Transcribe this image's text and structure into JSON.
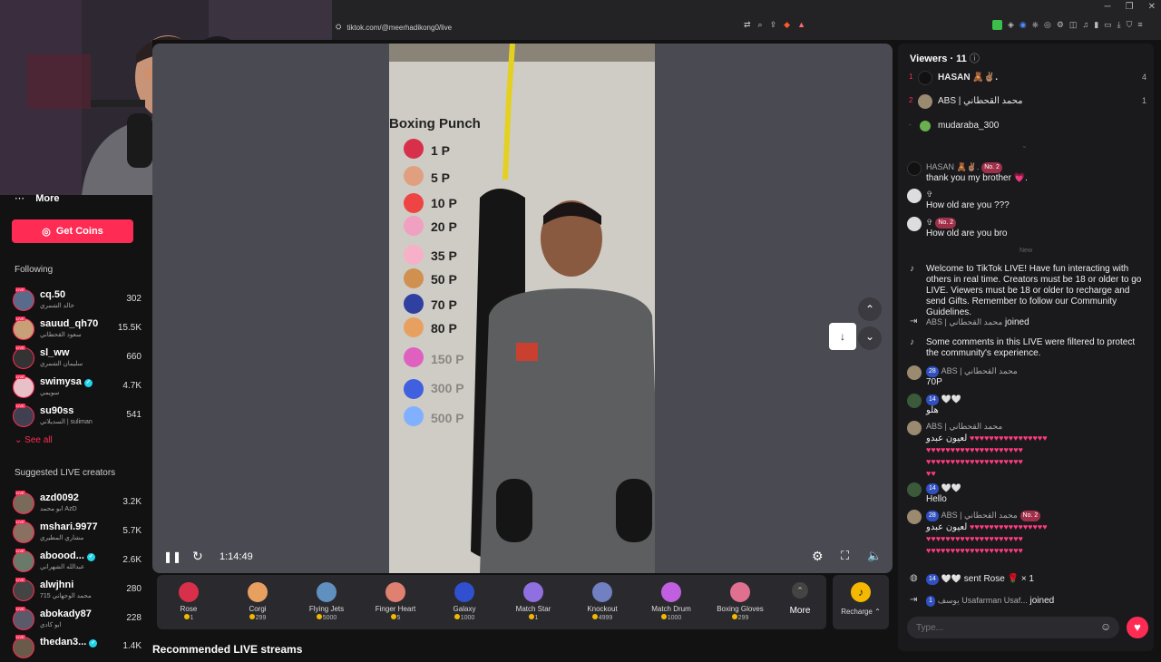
{
  "browser": {
    "url": "tiktok.com/@meerhadikong0/live",
    "window_controls": [
      "─",
      "❐",
      "✕"
    ]
  },
  "sidebar": {
    "more_label": "More",
    "get_coins_label": "Get Coins",
    "following_heading": "Following",
    "following": [
      {
        "name": "cq.50",
        "sub": "خالد الشمري",
        "count": "302"
      },
      {
        "name": "sauud_qh70",
        "sub": "سعود القحطاني",
        "count": "15.5K"
      },
      {
        "name": "sl_ww",
        "sub": "سليمان الشمري",
        "count": "660"
      },
      {
        "name": "swimysa",
        "sub": "سويمي",
        "count": "4.7K"
      },
      {
        "name": "su90ss",
        "sub": "السديلاني | suliman",
        "count": "541"
      }
    ],
    "see_all_label": "See all",
    "suggested_heading": "Suggested LIVE creators",
    "suggested": [
      {
        "name": "azd0092",
        "sub": "ابو محمد AzD",
        "count": "3.2K"
      },
      {
        "name": "mshari.9977",
        "sub": "مشاري المطيري",
        "count": "5.7K"
      },
      {
        "name": "aboood...",
        "sub": "عبدالله الشهراني",
        "count": "2.6K"
      },
      {
        "name": "alwjhni",
        "sub": "محمد الوجهاني 715",
        "count": "280"
      },
      {
        "name": "abokady87",
        "sub": "ابو كادي",
        "count": "228"
      },
      {
        "name": "thedan3...",
        "sub": "",
        "count": "1.4K"
      }
    ]
  },
  "video": {
    "title": "Boxing Punch",
    "prices": [
      "1 P",
      "5 P",
      "10 P",
      "20 P",
      "35 P",
      "50 P",
      "70 P",
      "80 P",
      "150 P",
      "300 P",
      "500 P"
    ],
    "time": "1:14:49"
  },
  "gifts": [
    {
      "name": "Rose",
      "price": "1"
    },
    {
      "name": "Corgi",
      "price": "299"
    },
    {
      "name": "Flying Jets",
      "price": "5000"
    },
    {
      "name": "Finger Heart",
      "price": "5"
    },
    {
      "name": "Galaxy",
      "price": "1000"
    },
    {
      "name": "Match Star",
      "price": "1"
    },
    {
      "name": "Knockout",
      "price": "4999"
    },
    {
      "name": "Match Drum",
      "price": "1000"
    },
    {
      "name": "Boxing Gloves",
      "price": "299"
    }
  ],
  "gift_more_label": "More",
  "recharge_label": "Recharge",
  "recommended_heading": "Recommended LIVE streams",
  "viewers": {
    "heading": "Viewers",
    "count": "11",
    "list": [
      {
        "rank": "1",
        "name": "HASAN 🧸✌🏽.",
        "score": "4"
      },
      {
        "rank": "2",
        "name": "ABS | محمد القحطاني",
        "score": "1"
      },
      {
        "rank": "-",
        "name": "mudaraba_300",
        "score": ""
      }
    ]
  },
  "chat": {
    "new_label": "New",
    "messages": [
      {
        "user": "HASAN 🧸✌🏽.",
        "badge": "No. 2",
        "text": "thank you my brother 💗."
      },
      {
        "user": "✞",
        "badge": "",
        "text": "How old are you ???"
      },
      {
        "user": "✞",
        "badge": "No. 2",
        "text": "How old are you bro"
      },
      {
        "user": "",
        "badge": "",
        "text": "Welcome to TikTok LIVE! Have fun interacting with others in real time. Creators must be 18 or older to go LIVE. Viewers must be 18 or older to recharge and send Gifts. Remember to follow our Community Guidelines."
      },
      {
        "user": "ABS | محمد القحطاني",
        "badge": "",
        "text": "joined"
      },
      {
        "user": "",
        "badge": "",
        "text": "Some comments in this LIVE were filtered to protect the community's experience."
      },
      {
        "user": "ABS | محمد القحطاني",
        "badge": "28",
        "text": "70P"
      },
      {
        "user": "🤍🤍",
        "badge": "14",
        "text": "هلو"
      },
      {
        "user": "ABS | محمد القحطاني",
        "badge": "",
        "text": "لعيون عبدو"
      },
      {
        "user": "🤍🤍",
        "badge": "14",
        "text": "Hello"
      },
      {
        "user": "ABS | محمد القحطاني",
        "badge": "28",
        "text": "لعيون عبدو"
      },
      {
        "user": "🤍🤍",
        "badge": "14",
        "text": "sent Rose 🌹 × 1"
      },
      {
        "user": "يوسف Usafarman Usaf...",
        "badge": "1",
        "text": "joined"
      }
    ],
    "no2_badge": "No. 2",
    "type_placeholder": "Type..."
  },
  "colors": {
    "accent": "#fe2c55",
    "verified": "#20d5ec",
    "coin": "#f5b800"
  }
}
